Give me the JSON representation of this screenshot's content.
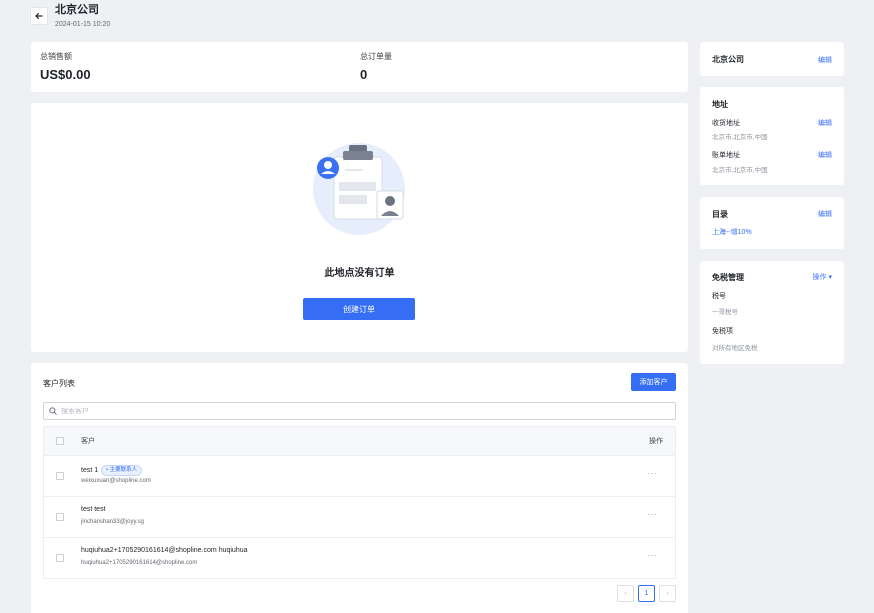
{
  "header": {
    "title": "北京公司",
    "timestamp": "2024-01-15 10:20"
  },
  "stats": {
    "total_sales_label": "总销售额",
    "total_sales_value": "US$0.00",
    "total_orders_label": "总订单量",
    "total_orders_value": "0"
  },
  "empty_state": {
    "message": "此地点没有订单",
    "create_button": "创建订单"
  },
  "customers": {
    "title": "客户列表",
    "add_button": "添加客户",
    "search_placeholder": "搜索客户",
    "columns": {
      "customer": "客户",
      "action": "操作"
    },
    "rows": [
      {
        "name": "test 1",
        "tag": "• 主要联系人",
        "email": "weixuxuan@shopline.com",
        "more": "···"
      },
      {
        "name": "test test",
        "tag": "",
        "email": "jinchanshan33@joyy.sg",
        "more": "···"
      },
      {
        "name": "huqiuhua2+1705290161614@shopline.com huqiuhua",
        "tag": "",
        "email": "huqiuhua2+1705290161614@shopline.com",
        "more": "···"
      }
    ],
    "pagination": {
      "prev": "‹",
      "current": "1",
      "next": "›"
    }
  },
  "sidebar": {
    "company": {
      "name": "北京公司",
      "edit": "编辑"
    },
    "address": {
      "title": "地址",
      "shipping_label": "收货地址",
      "shipping_value": "北京市,北京市,中国",
      "billing_label": "账单地址",
      "billing_value": "北京市,北京市,中国",
      "edit": "编辑"
    },
    "catalog": {
      "title": "目录",
      "edit": "编辑",
      "value": "上海--增10%"
    },
    "tax": {
      "title": "免税管理",
      "action": "操作 ▾",
      "tax_id_label": "税号",
      "tax_id_value": "一哥税号",
      "exempt_label": "免税项",
      "exempt_value": "对所有地区免税"
    }
  },
  "colors": {
    "primary": "#356ef5",
    "background": "#eef0f4"
  },
  "icons": [
    "back-arrow-icon",
    "search-icon",
    "clipboard-illustration"
  ]
}
